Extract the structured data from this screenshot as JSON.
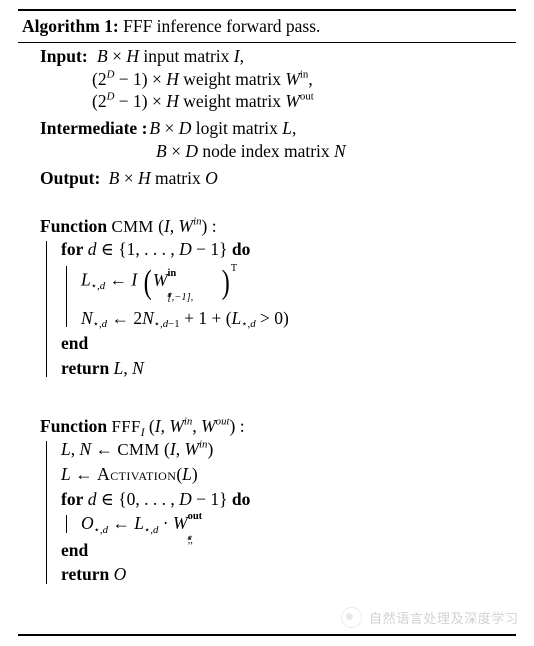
{
  "algorithm": {
    "caption": {
      "label": "Algorithm 1:",
      "title": "FFF inference forward pass."
    },
    "io": {
      "input_label": "Input:",
      "input_lines": [
        "B × H input matrix I,",
        "(2^D − 1) × H weight matrix W^in,",
        "(2^D − 1) × H weight matrix W^out"
      ],
      "intermediate_label": "Intermediate :",
      "intermediate_lines": [
        "B × D logit matrix L,",
        "B × D node index matrix N"
      ],
      "output_label": "Output:",
      "output_line": "B × H matrix O"
    },
    "functions": [
      {
        "keyword": "Function",
        "name": "CMM",
        "signature": "(I, W^in) :",
        "body": [
          {
            "kind": "for",
            "keyword_for": "for",
            "keyword_do": "do",
            "condition": "d ∈ {1, . . . , D − 1}",
            "keyword_end": "end",
            "statements": [
              "L⋆,d ← I (W^in_[N⋆,d−1],⋆)^T",
              "N⋆,d ← 2N⋆,d−1 + 1 + (L⋆,d > 0)"
            ]
          },
          {
            "kind": "return",
            "keyword": "return",
            "value": "L, N"
          }
        ]
      },
      {
        "keyword": "Function",
        "name": "FFF",
        "name_subscript": "I",
        "signature": "(I, W^in, W^out) :",
        "body": [
          {
            "kind": "assign",
            "text": "L, N ← CMM (I, W^in)"
          },
          {
            "kind": "assign",
            "text": "L ← Activation(L)"
          },
          {
            "kind": "for",
            "keyword_for": "for",
            "keyword_do": "do",
            "condition": "d ∈ {0, . . . , D − 1}",
            "keyword_end": "end",
            "statements": [
              "O⋆,d ← L⋆,d · W^out_N⋆,d,⋆"
            ]
          },
          {
            "kind": "return",
            "keyword": "return",
            "value": "O"
          }
        ]
      }
    ]
  },
  "watermark": {
    "text": "自然语言处理及深度学习",
    "logo_icon": "circle-dotted-logo-icon"
  },
  "colors": {
    "background": "#ffffff",
    "text": "#000000",
    "watermark_text": "#8d939b"
  }
}
